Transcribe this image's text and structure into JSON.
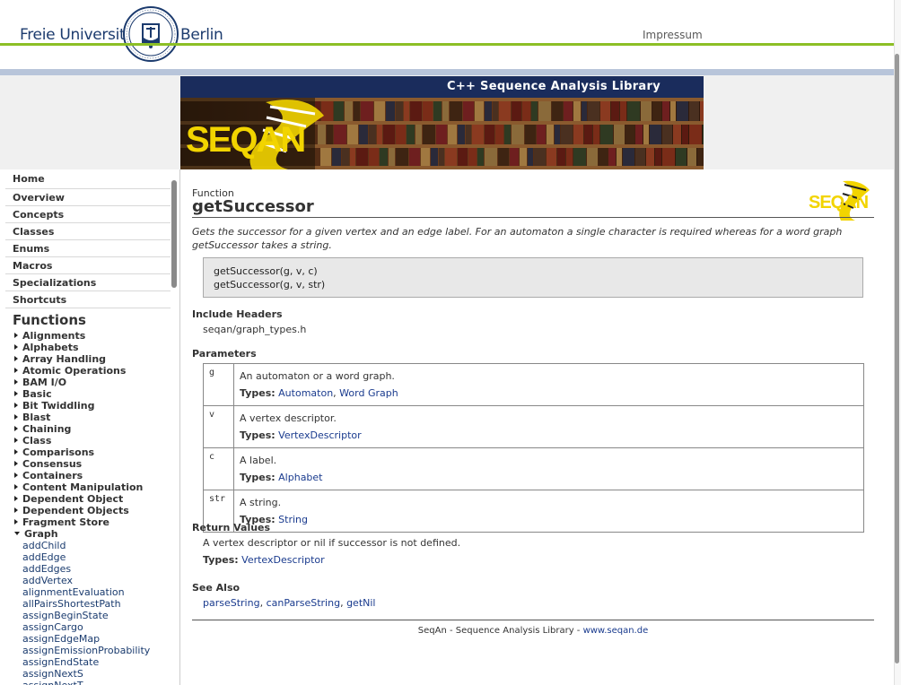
{
  "header": {
    "university_left": "Freie Universität",
    "university_right": "Berlin",
    "impressum": "Impressum"
  },
  "banner": {
    "title": "C++ Sequence Analysis Library",
    "logo_text": "SEQAN"
  },
  "sidebar": {
    "nav": [
      "Home",
      "Overview",
      "Concepts",
      "Classes",
      "Enums",
      "Macros",
      "Specializations",
      "Shortcuts"
    ],
    "heading": "Functions",
    "categories": [
      "Alignments",
      "Alphabets",
      "Array Handling",
      "Atomic Operations",
      "BAM I/O",
      "Basic",
      "Bit Twiddling",
      "Blast",
      "Chaining",
      "Class",
      "Comparisons",
      "Consensus",
      "Containers",
      "Content Manipulation",
      "Dependent Object",
      "Dependent Objects",
      "Fragment Store"
    ],
    "expanded_category": "Graph",
    "graph_functions": [
      "addChild",
      "addEdge",
      "addEdges",
      "addVertex",
      "alignmentEvaluation",
      "allPairsShortestPath",
      "assignBeginState",
      "assignCargo",
      "assignEdgeMap",
      "assignEmissionProbability",
      "assignEndState",
      "assignNextS",
      "assignNextT"
    ]
  },
  "main": {
    "kind": "Function",
    "title": "getSuccessor",
    "logo_text": "SEQAN",
    "description": "Gets the successor for a given vertex and an edge label. For an automaton a single character is required whereas for a word graph getSuccessor takes a string.",
    "signatures": [
      "getSuccessor(g, v, c)",
      "getSuccessor(g, v, str)"
    ],
    "include_heading": "Include Headers",
    "include": "seqan/graph_types.h",
    "params_heading": "Parameters",
    "types_label": "Types:",
    "params": [
      {
        "name": "g",
        "desc": "An automaton or a word graph.",
        "types": [
          "Automaton",
          "Word Graph"
        ]
      },
      {
        "name": "v",
        "desc": "A vertex descriptor.",
        "types": [
          "VertexDescriptor"
        ]
      },
      {
        "name": "c",
        "desc": "A label.",
        "types": [
          "Alphabet"
        ]
      },
      {
        "name": "str",
        "desc": "A string.",
        "types": [
          "String"
        ]
      }
    ],
    "return_heading": "Return Values",
    "return_text": "A vertex descriptor or nil if successor is not defined.",
    "return_type": "VertexDescriptor",
    "see_also_heading": "See Also",
    "see_also": [
      "parseString",
      "canParseString",
      "getNil"
    ],
    "footer_text": "SeqAn - Sequence Analysis Library - ",
    "footer_link": "www.seqan.de"
  },
  "colors": {
    "fu_blue": "#1c3b6e",
    "fu_green": "#8cbf26",
    "banner_navy": "#1a2c5c",
    "link": "#1a3b8e",
    "seqan_yellow": "#f2d400"
  }
}
